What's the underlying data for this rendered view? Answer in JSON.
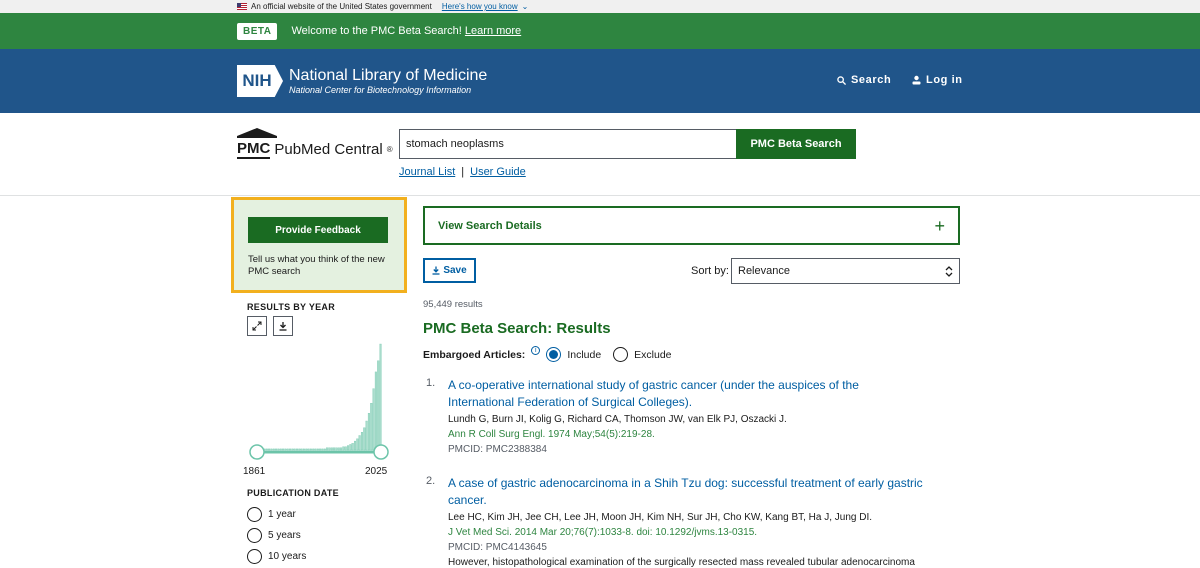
{
  "gov_banner": {
    "text": "An official website of the United States government",
    "link": "Here's how you know"
  },
  "beta": {
    "tag": "BETA",
    "message": "Welcome to the PMC Beta Search!",
    "link": "Learn more"
  },
  "header": {
    "logo_badge": "NIH",
    "title": "National Library of Medicine",
    "subtitle": "National Center for Biotechnology Information",
    "search": "Search",
    "login": "Log in"
  },
  "pmc": {
    "abbr": "PMC",
    "name": "PubMed Central",
    "reg": "®"
  },
  "search": {
    "query": "stomach neoplasms",
    "button": "PMC Beta Search",
    "journal_list": "Journal List",
    "separator": "|",
    "user_guide": "User Guide"
  },
  "feedback": {
    "button": "Provide Feedback",
    "text": "Tell us what you think of the new PMC search"
  },
  "sidebar": {
    "results_by_year": "RESULTS BY YEAR",
    "year_start": "1861",
    "year_end": "2025",
    "publication_date": "PUBLICATION DATE",
    "date_options": [
      "1 year",
      "5 years",
      "10 years"
    ]
  },
  "histogram": {
    "values": [
      1,
      1,
      1,
      1,
      1,
      1,
      1,
      1,
      1,
      1,
      1,
      1,
      1,
      1,
      1,
      1,
      1,
      1,
      1,
      1,
      1,
      1,
      1,
      1,
      1,
      1,
      1,
      1,
      1,
      2,
      2,
      2,
      2,
      2,
      2,
      2,
      3,
      3,
      4,
      5,
      6,
      8,
      10,
      13,
      16,
      20,
      26,
      33,
      42,
      55,
      70,
      80,
      95
    ]
  },
  "details": {
    "label": "View Search Details"
  },
  "toolbar": {
    "save": "Save",
    "sort_label": "Sort by:",
    "sort_value": "Relevance"
  },
  "results": {
    "count": "95,449 results",
    "title": "PMC Beta Search: Results",
    "embargo_label": "Embargoed Articles:",
    "include": "Include",
    "exclude": "Exclude",
    "items": [
      {
        "num": "1.",
        "title": "A co-operative international study of gastric cancer (under the auspices of the International Federation of Surgical Colleges).",
        "authors": "Lundh G, Burn JI, Kolig G, Richard CA, Thomson JW, van Elk PJ, Oszacki J.",
        "cite": "Ann R Coll Surg Engl. 1974 May;54(5):219-28.",
        "pmcid": "PMCID: PMC2388384"
      },
      {
        "num": "2.",
        "title": "A case of gastric adenocarcinoma in a Shih Tzu dog: successful treatment of early gastric cancer.",
        "authors": "Lee HC, Kim JH, Jee CH, Lee JH, Moon JH, Kim NH, Sur JH, Cho KW, Kang BT, Ha J, Jung DI.",
        "cite": "J Vet Med Sci. 2014 Mar 20;76(7):1033-8. doi: 10.1292/jvms.13-0315.",
        "pmcid": "PMCID: PMC4143645",
        "snippet": "However, histopathological examination of the surgically resected mass revealed tubular adenocarcinoma"
      }
    ]
  }
}
